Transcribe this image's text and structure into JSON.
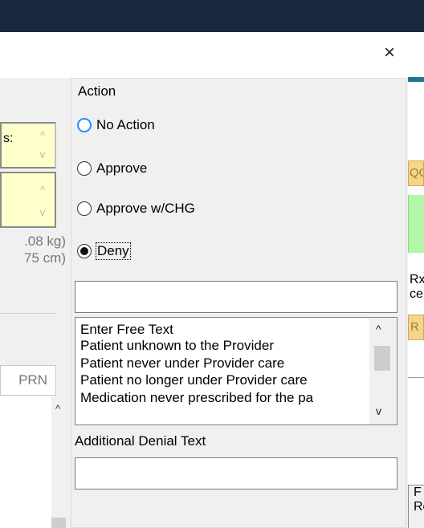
{
  "dialog": {
    "close_symbol": "×",
    "action_group": {
      "title": "Action",
      "options": [
        {
          "label": "No Action",
          "checked": false,
          "focused": true
        },
        {
          "label": "Approve",
          "checked": false
        },
        {
          "label": "Approve w/CHG",
          "checked": false
        },
        {
          "label": "Deny",
          "checked": true
        }
      ]
    },
    "denial_reason_input": {
      "value": ""
    },
    "denial_reasons": [
      "Enter Free Text",
      "Patient unknown to the Provider",
      "Patient never under Provider care",
      "Patient no longer under Provider care",
      "Medication never prescribed for the pa"
    ],
    "additional_denial_label": "Additional Denial Text",
    "additional_denial_input": {
      "value": ""
    }
  },
  "background_left": {
    "field_label_fragment": "s:",
    "weight_fragment": ".08 kg)",
    "height_fragment": "75 cm)",
    "column_prn": "PRN"
  },
  "background_right": {
    "tan_label": "QC",
    "rx_line1": "Rx",
    "rx_line2": "ce",
    "button_fragment": "R",
    "bottom_line1": "F",
    "bottom_line2": "Re"
  },
  "icons": {
    "scroll_up": "^",
    "scroll_down": "v"
  },
  "colors": {
    "titlebar": "#18283e",
    "yellow_field": "#ffffcc",
    "tan_button": "#f4d58a",
    "green_panel": "#b3f7a7",
    "radio_focus": "#1e90ff"
  }
}
